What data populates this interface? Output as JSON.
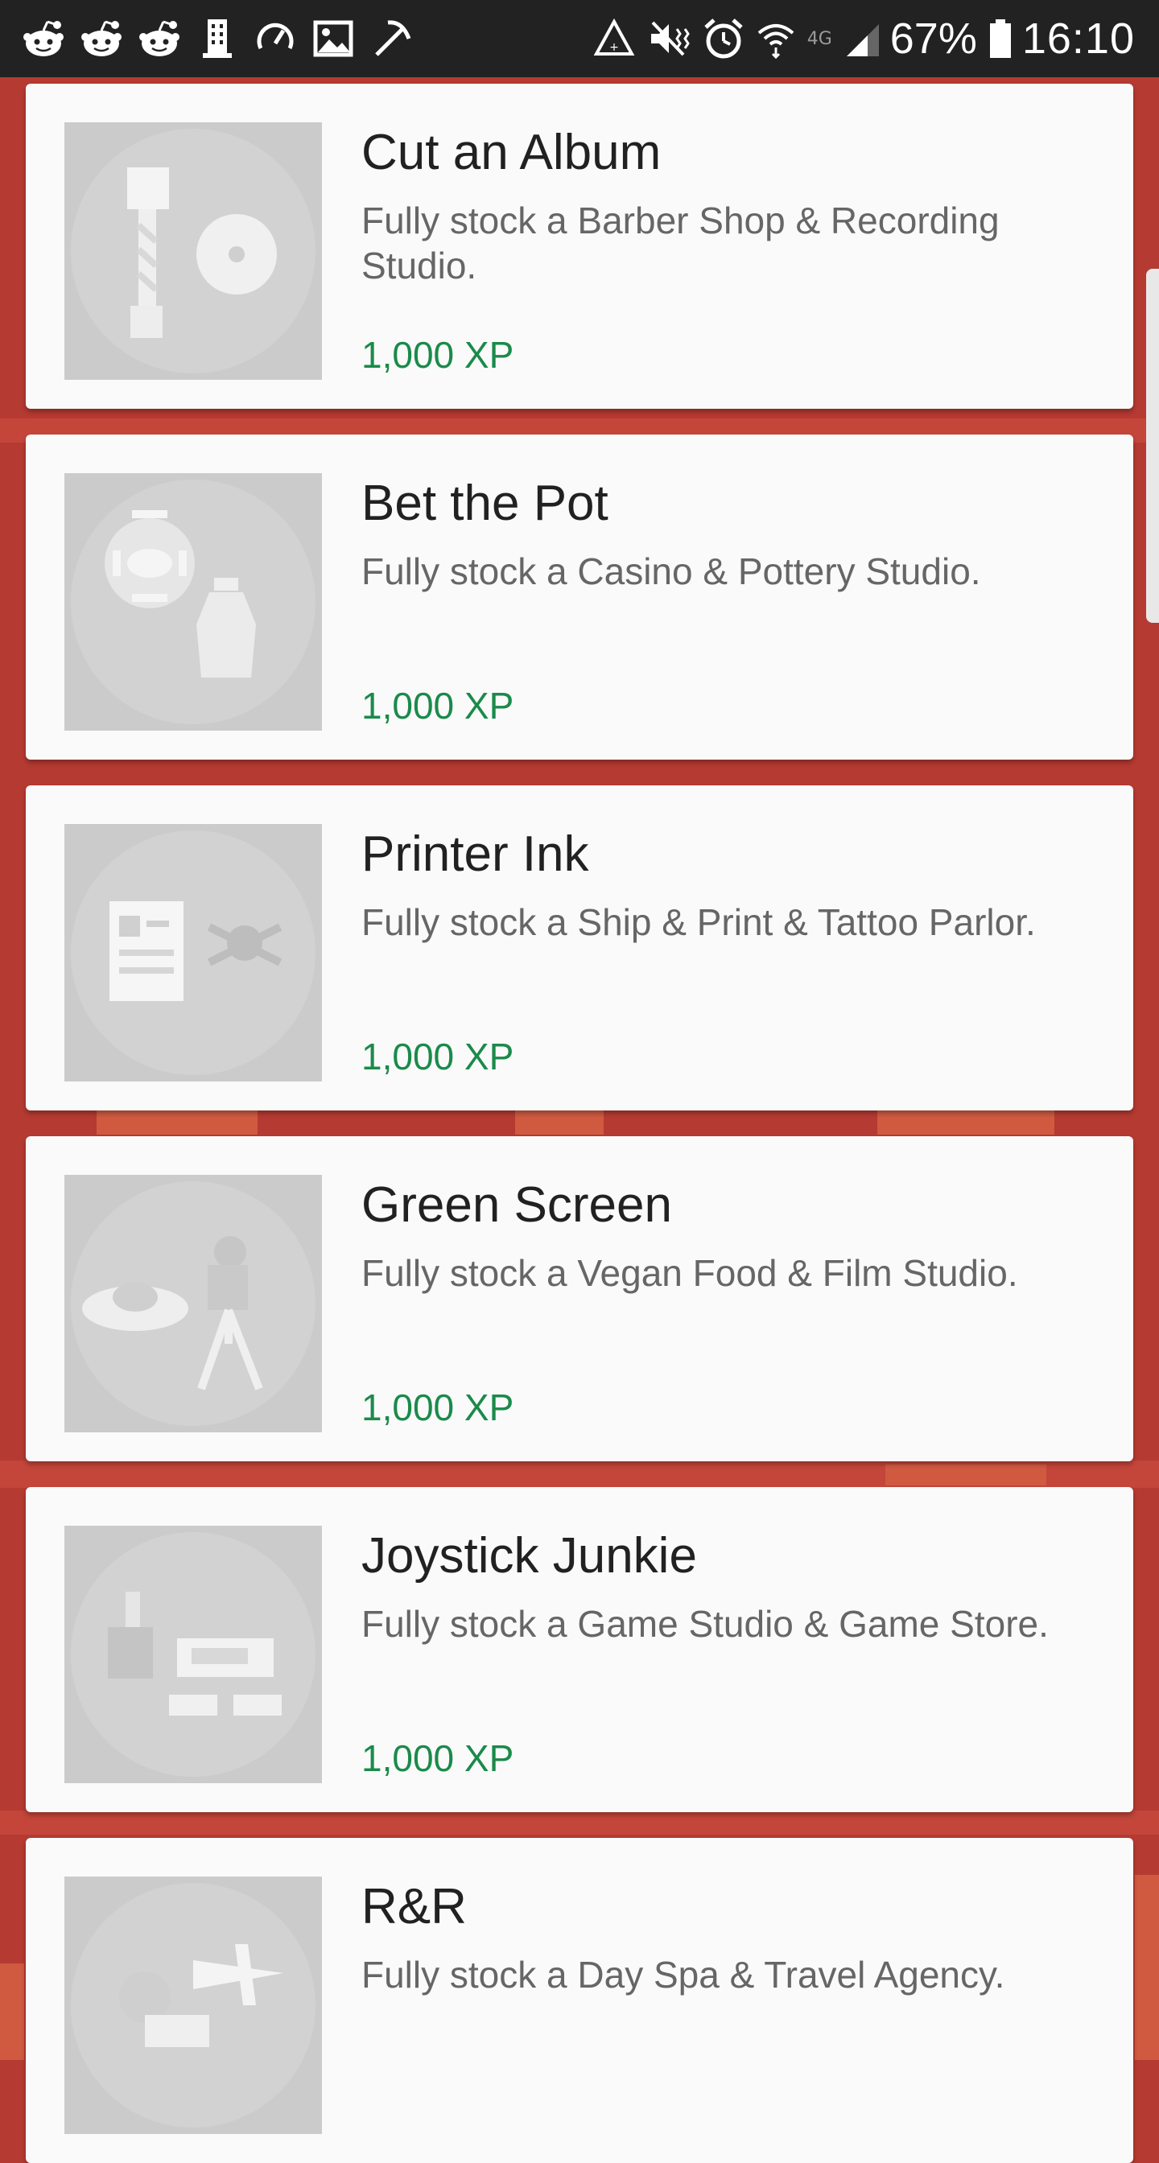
{
  "status_bar": {
    "left_icons": [
      "reddit-icon",
      "reddit-icon",
      "reddit-icon",
      "building-icon",
      "speedometer-icon",
      "image-icon",
      "pickaxe-icon"
    ],
    "right_icons": [
      "recycle-icon",
      "vibrate-mute-icon",
      "alarm-icon",
      "wifi-icon",
      "lte-icon",
      "signal-icon"
    ],
    "lte_label": "4G",
    "battery": "67%",
    "time": "16:10"
  },
  "achievements": [
    {
      "title": "Cut an Album",
      "description": "Fully stock a Barber Shop & Recording Studio.",
      "xp": "1,000 XP",
      "icon": "barber-pole-and-record-icon"
    },
    {
      "title": "Bet the Pot",
      "description": "Fully stock a Casino & Pottery Studio.",
      "xp": "1,000 XP",
      "icon": "poker-chip-and-vase-icon"
    },
    {
      "title": "Printer Ink",
      "description": "Fully stock a Ship & Print & Tattoo Parlor.",
      "xp": "1,000 XP",
      "icon": "paper-and-skull-icon"
    },
    {
      "title": "Green Screen",
      "description": "Fully stock a Vegan Food & Film Studio.",
      "xp": "1,000 XP",
      "icon": "salad-and-camera-icon"
    },
    {
      "title": "Joystick Junkie",
      "description": "Fully stock a Game Studio & Game Store.",
      "xp": "1,000 XP",
      "icon": "joystick-and-console-icon"
    },
    {
      "title": "R&R",
      "description": "Fully stock a Day Spa & Travel Agency.",
      "xp": "",
      "icon": "spa-and-airplane-icon"
    }
  ],
  "colors": {
    "background": "#b53a32",
    "card": "#fafafa",
    "xp_text": "#1b8a4a",
    "title_text": "#212121",
    "description_text": "#666666"
  }
}
